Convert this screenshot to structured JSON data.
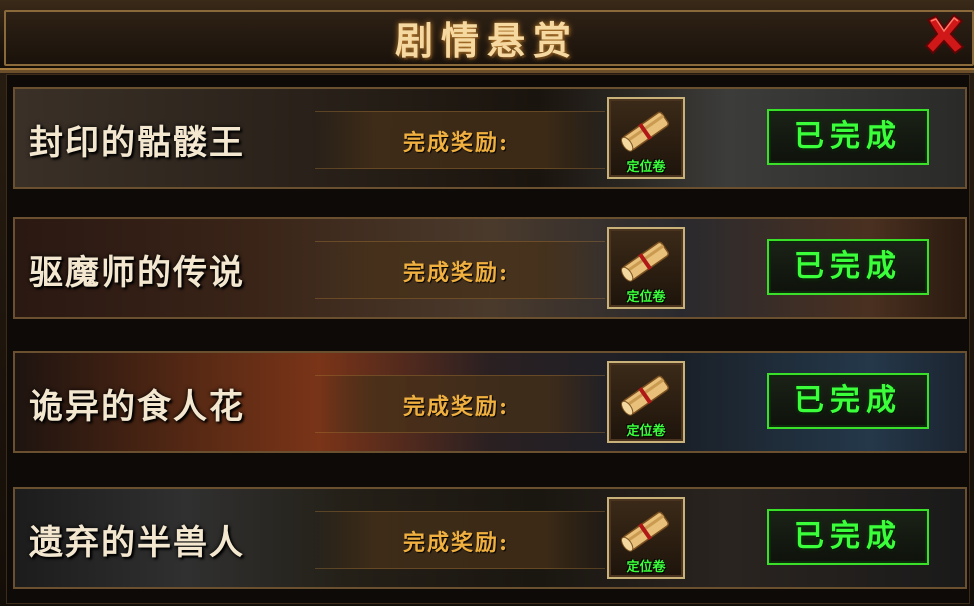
{
  "window": {
    "title": "剧情悬赏"
  },
  "colors": {
    "title": "#f6d9a0",
    "reward_label": "#f0b040",
    "status_green": "#3cff3c",
    "frame_gold": "#8a6a3a"
  },
  "quests": [
    {
      "name": "封印的骷髅王",
      "reward_label": "完成奖励:",
      "reward_item": "定位卷",
      "reward_icon": "scroll-icon",
      "status": "已完成"
    },
    {
      "name": "驱魔师的传说",
      "reward_label": "完成奖励:",
      "reward_item": "定位卷",
      "reward_icon": "scroll-icon",
      "status": "已完成"
    },
    {
      "name": "诡异的食人花",
      "reward_label": "完成奖励:",
      "reward_item": "定位卷",
      "reward_icon": "scroll-icon",
      "status": "已完成"
    },
    {
      "name": "遗弃的半兽人",
      "reward_label": "完成奖励:",
      "reward_item": "定位卷",
      "reward_icon": "scroll-icon",
      "status": "已完成"
    }
  ]
}
